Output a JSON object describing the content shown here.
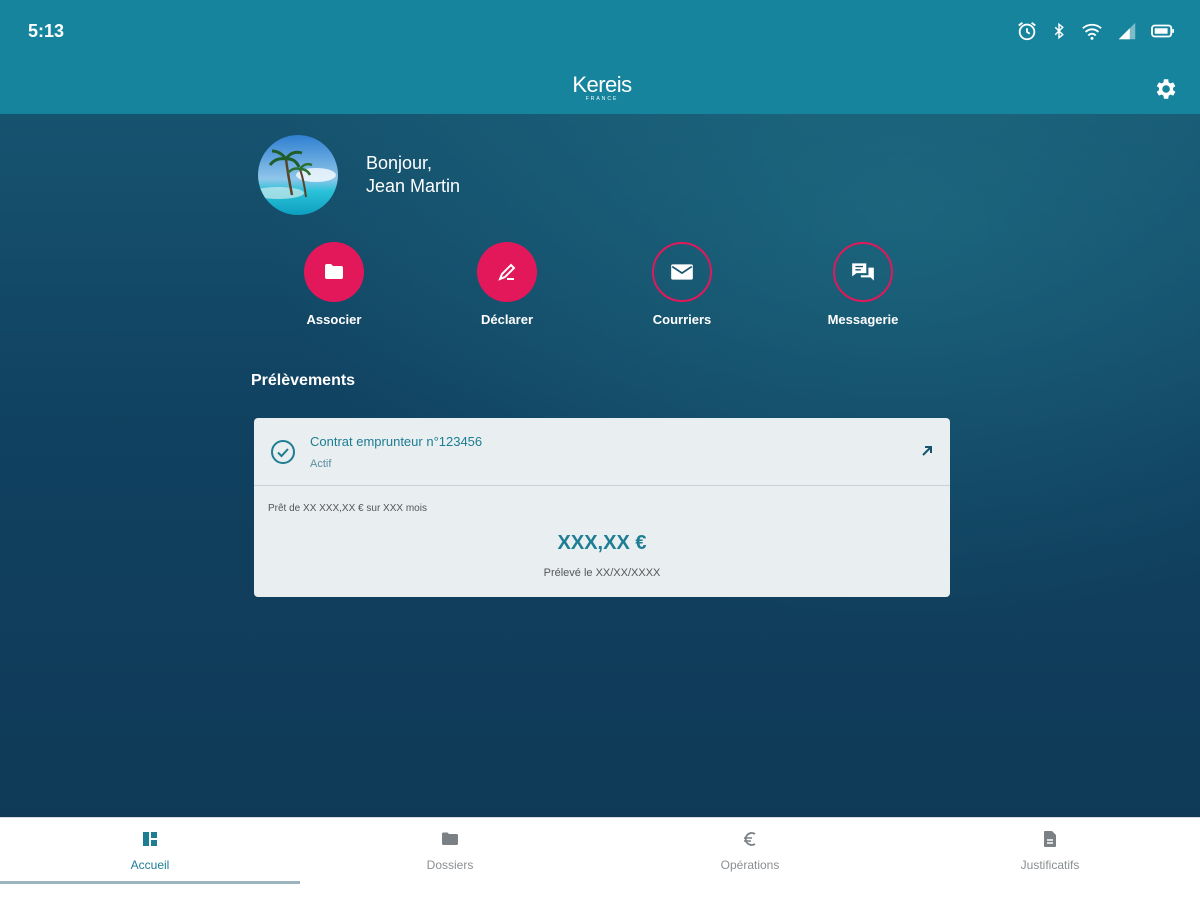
{
  "status_bar": {
    "time": "5:13",
    "icons": [
      "alarm-icon",
      "bluetooth-icon",
      "wifi-icon",
      "signal-icon",
      "battery-icon"
    ]
  },
  "app_bar": {
    "logo_text": "Kereis",
    "logo_subtext": "FRANCE",
    "settings_icon": "gear-icon"
  },
  "profile": {
    "greeting_line1": "Bonjour,",
    "greeting_line2": "Jean Martin"
  },
  "actions": [
    {
      "label": "Associer",
      "icon": "folder-icon",
      "style": "filled"
    },
    {
      "label": "Déclarer",
      "icon": "edit-icon",
      "style": "filled"
    },
    {
      "label": "Courriers",
      "icon": "mail-icon",
      "style": "outline"
    },
    {
      "label": "Messagerie",
      "icon": "chat-icon",
      "style": "outline"
    }
  ],
  "section": {
    "title": "Prélèvements"
  },
  "card": {
    "contract_title": "Contrat emprunteur n°123456",
    "contract_status": "Actif",
    "loan_description": "Prêt de XX XXX,XX € sur XXX mois",
    "amount": "XXX,XX €",
    "debit_date": "Prélevé le XX/XX/XXXX"
  },
  "bottom_nav": [
    {
      "label": "Accueil",
      "icon": "dashboard-icon",
      "active": true
    },
    {
      "label": "Dossiers",
      "icon": "folder-icon",
      "active": false
    },
    {
      "label": "Opérations",
      "icon": "euro-icon",
      "active": false
    },
    {
      "label": "Justificatifs",
      "icon": "document-icon",
      "active": false
    }
  ],
  "colors": {
    "primary": "#15849c",
    "accent": "#e2185b",
    "background": "#0f3a57",
    "card": "#e9eef0",
    "teal_text": "#1d7d93"
  }
}
